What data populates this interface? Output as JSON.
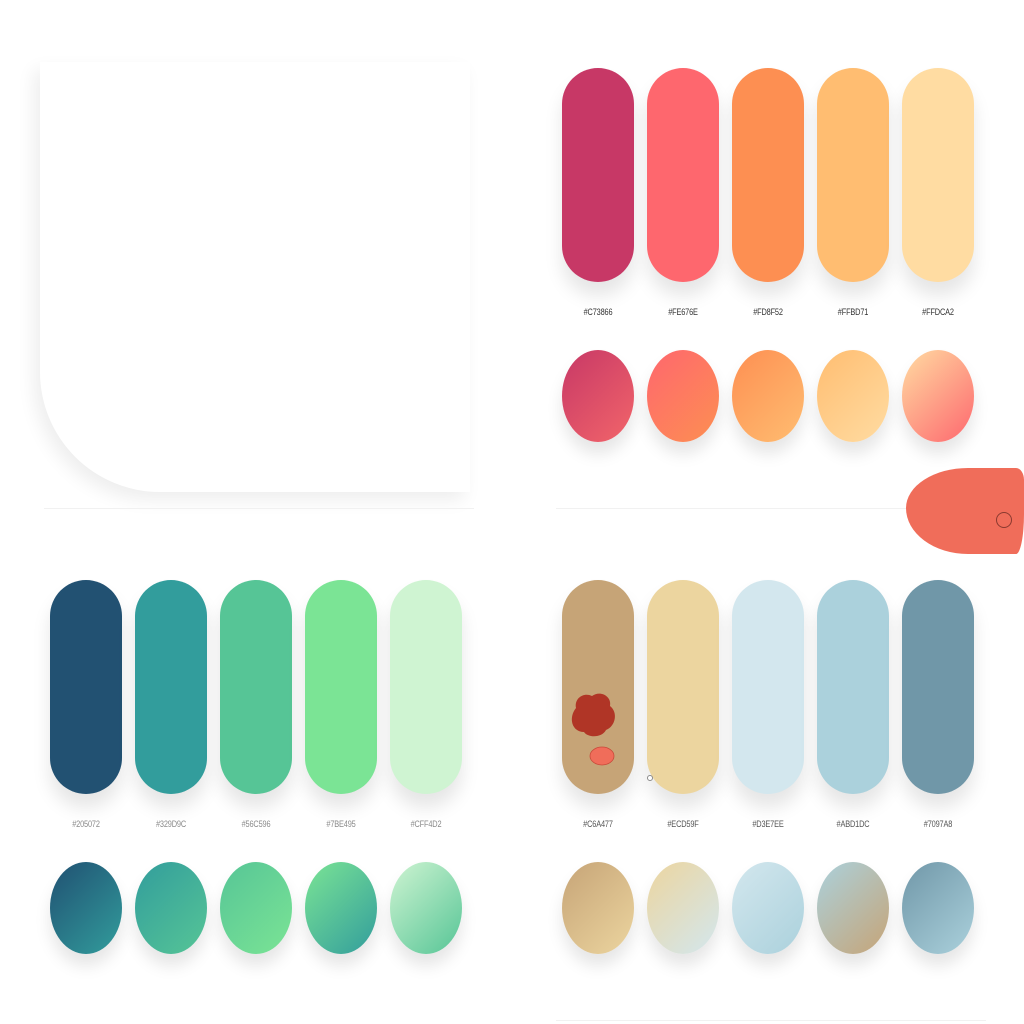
{
  "palettes": [
    {
      "id": "warm",
      "swatches": [
        {
          "hex": "#C73866",
          "color": "#C73866"
        },
        {
          "hex": "#FE676E",
          "color": "#FE676E"
        },
        {
          "hex": "#FD8F52",
          "color": "#FD8F52"
        },
        {
          "hex": "#FFBD71",
          "color": "#FFBD71"
        },
        {
          "hex": "#FFDCA2",
          "color": "#FFDCA2"
        }
      ],
      "gradients": [
        [
          "#C73866",
          "#F2656A"
        ],
        [
          "#FE676E",
          "#FD8F52"
        ],
        [
          "#FD8F52",
          "#FFBD71"
        ],
        [
          "#FFBD71",
          "#FFDCA2"
        ],
        [
          "#FFDCA2",
          "#FE676E"
        ]
      ],
      "label_color": "#333333"
    },
    {
      "id": "green",
      "swatches": [
        {
          "hex": "#205072",
          "color": "#225172"
        },
        {
          "hex": "#329D9C",
          "color": "#329D9C"
        },
        {
          "hex": "#56C596",
          "color": "#56C596"
        },
        {
          "hex": "#7BE495",
          "color": "#7BE495"
        },
        {
          "hex": "#CFF4D2",
          "color": "#CFF4D2"
        }
      ],
      "gradients": [
        [
          "#205072",
          "#329D9C"
        ],
        [
          "#329D9C",
          "#56C596"
        ],
        [
          "#56C596",
          "#7BE495"
        ],
        [
          "#7BE495",
          "#329D9C"
        ],
        [
          "#CFF4D2",
          "#56C596"
        ]
      ],
      "label_color": "#8a8a8a"
    },
    {
      "id": "sand-sky",
      "swatches": [
        {
          "hex": "#C6A477",
          "color": "#C6A477"
        },
        {
          "hex": "#ECD59F",
          "color": "#ECD59F"
        },
        {
          "hex": "#D3E7EE",
          "color": "#D3E7EE"
        },
        {
          "hex": "#ABD1DC",
          "color": "#ABD1DC"
        },
        {
          "hex": "#7097A8",
          "color": "#7097A8"
        }
      ],
      "gradients": [
        [
          "#C6A477",
          "#ECD59F"
        ],
        [
          "#ECD59F",
          "#D3E7EE"
        ],
        [
          "#D3E7EE",
          "#ABD1DC"
        ],
        [
          "#ABD1DC",
          "#C6A477"
        ],
        [
          "#7097A8",
          "#ABD1DC"
        ]
      ],
      "label_color": "#555555"
    }
  ],
  "colors": {
    "background": "#FFFFFF",
    "blob": "#F06D5A",
    "stain_dark": "#B03526",
    "stain_light": "#F06D5A"
  }
}
